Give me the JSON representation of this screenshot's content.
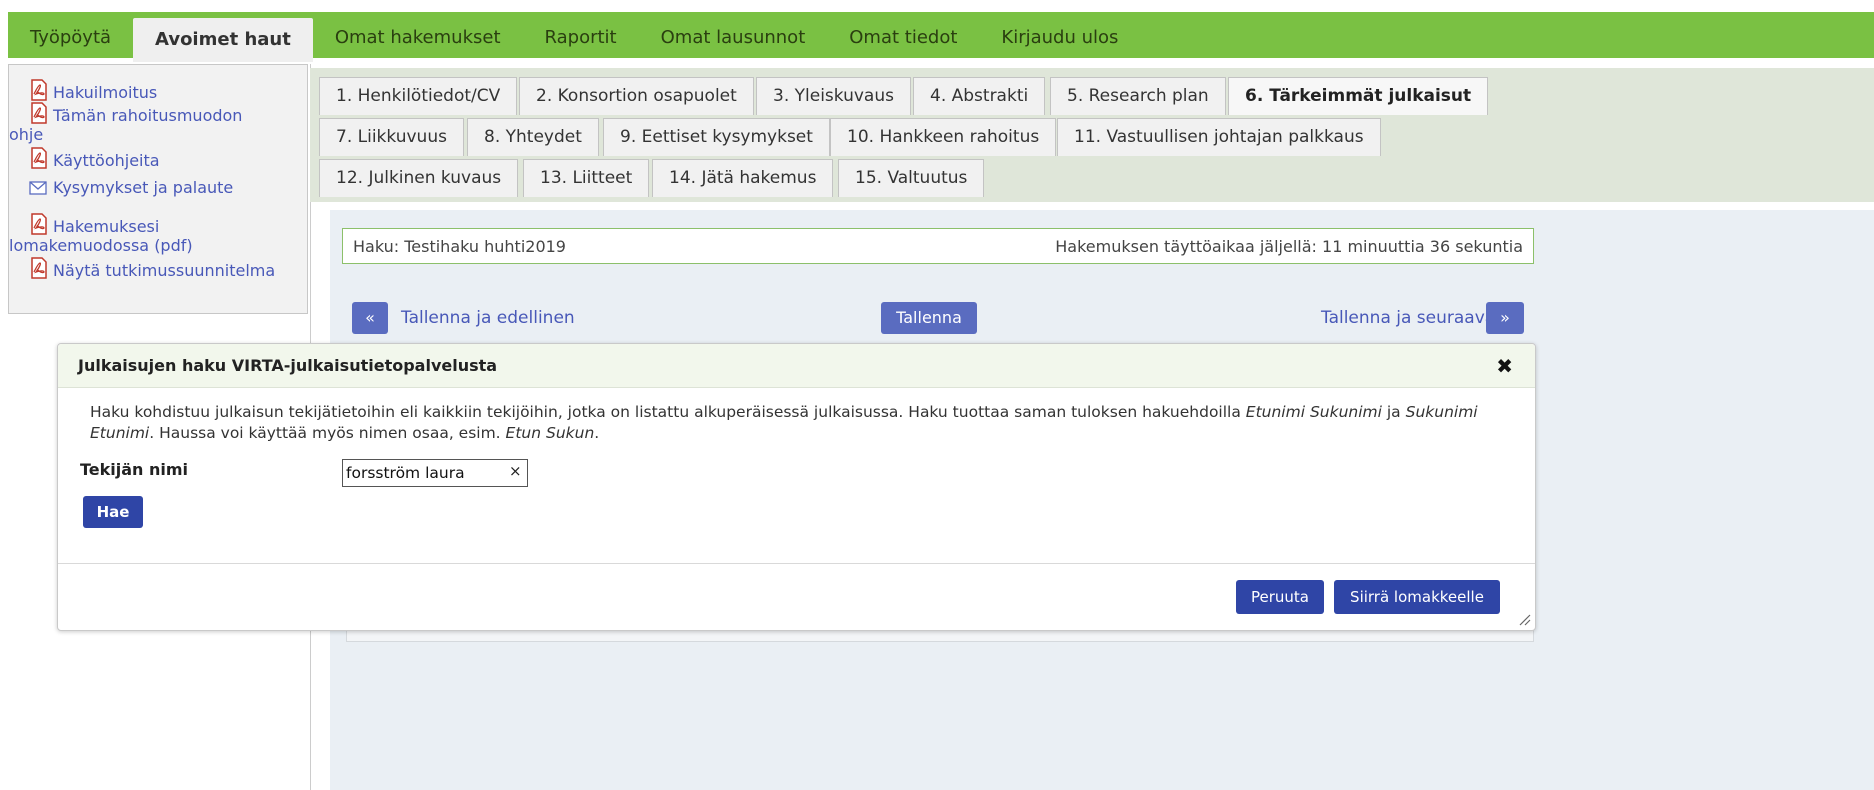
{
  "topnav": {
    "items": [
      "Työpöytä",
      "Avoimet haut",
      "Omat hakemukset",
      "Raportit",
      "Omat lausunnot",
      "Omat tiedot",
      "Kirjaudu ulos"
    ],
    "active_index": 1
  },
  "sidebar": {
    "links": [
      {
        "label": "Hakuilmoitus",
        "icon": "pdf-icon"
      },
      {
        "label": "Tämän rahoitusmuodon",
        "label2": "ohje",
        "icon": "pdf-icon"
      },
      {
        "label": "Käyttöohjeita",
        "icon": "pdf-icon"
      },
      {
        "label": "Kysymykset ja palaute",
        "icon": "mail-icon"
      },
      {
        "label": "Hakemuksesi",
        "label2": "lomakemuodossa (pdf)",
        "icon": "pdf-icon"
      },
      {
        "label": "Näytä tutkimussuunnitelma",
        "icon": "pdf-icon"
      }
    ]
  },
  "tabs": [
    "1. Henkilötiedot/CV",
    "2. Konsortion osapuolet",
    "3. Yleiskuvaus",
    "4. Abstrakti",
    "5. Research plan",
    "6. Tärkeimmät julkaisut",
    "7. Liikkuvuus",
    "8. Yhteydet",
    "9. Eettiset kysymykset",
    "10. Hankkeen rahoitus",
    "11. Vastuullisen johtajan palkkaus",
    "12. Julkinen kuvaus",
    "13. Liitteet",
    "14. Jätä hakemus",
    "15. Valtuutus"
  ],
  "active_tab_index": 5,
  "haku": {
    "left": "Haku: Testihaku huhti2019",
    "right": "Hakemuksen täyttöaikaa jäljellä: 11 minuuttia 36 sekuntia"
  },
  "navrow": {
    "prev_icon": "«",
    "prev_label": "Tallenna ja edellinen",
    "save_label": "Tallenna",
    "next_label": "Tallenna ja seuraava",
    "next_icon": "»"
  },
  "modal": {
    "title": "Julkaisujen haku VIRTA-julkaisutietopalvelusta",
    "close_icon": "✖",
    "desc_parts": {
      "a": "Haku kohdistuu julkaisun tekijätietoihin eli kaikkiin tekijöihin, jotka on listattu alkuperäisessä julkaisussa. Haku tuottaa saman tuloksen hakuehdoilla ",
      "b": "Etunimi Sukunimi",
      "c": " ja ",
      "d": "Sukunimi Etunimi",
      "e": ". Haussa voi käyttää myös nimen osaa, esim. ",
      "f": "Etun Sukun",
      "g": "."
    },
    "field_label": "Tekijän nimi",
    "field_value": "forsström laura",
    "clear_icon": "×",
    "search_label": "Hae",
    "cancel_label": "Peruuta",
    "transfer_label": "Siirrä lomakkeelle"
  },
  "colors": {
    "nav_green": "#7ac143",
    "button_blue": "#2f45a6",
    "link_blue": "#4858b8"
  }
}
